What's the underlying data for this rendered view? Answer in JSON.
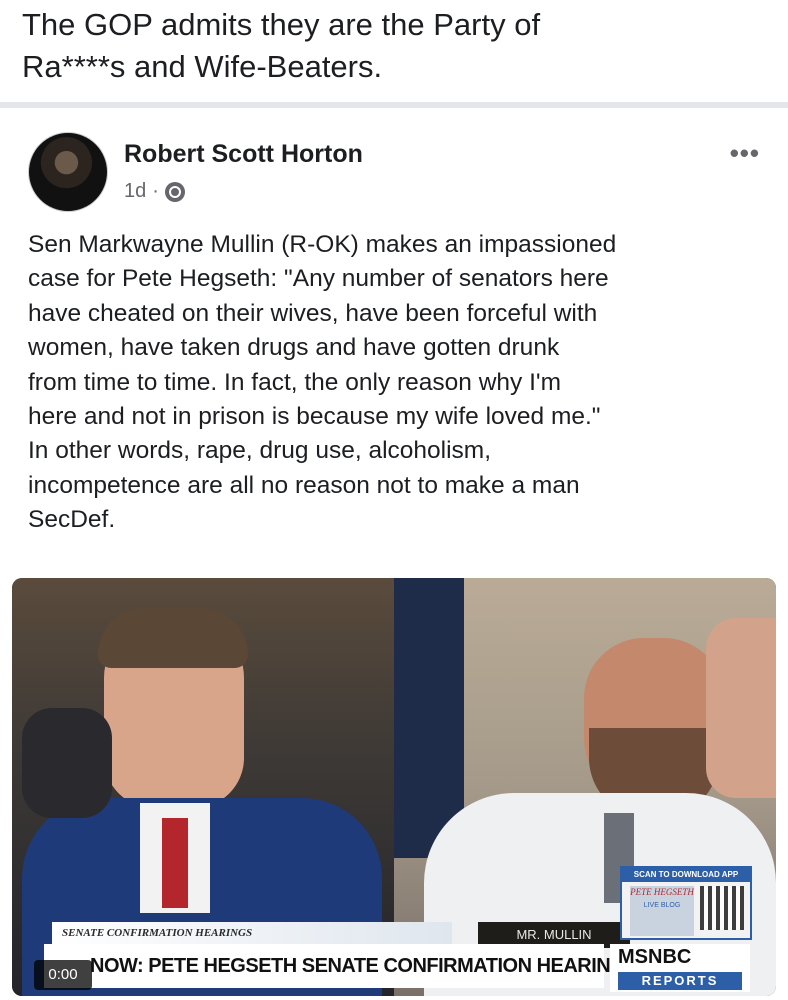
{
  "caption": {
    "line1": "The GOP admits they are the Party of",
    "line2": "Ra****s and Wife-Beaters."
  },
  "post": {
    "author": "Robert Scott Horton",
    "time": "1d",
    "separator": "·",
    "more_icon": "more-horizontal-icon",
    "privacy_icon": "globe-icon",
    "text_lines": [
      "Sen Markwayne Mullin (R-OK) makes an impassioned",
      "case for Pete Hegseth: \"Any number of senators here",
      "have cheated on their wives, have been forceful with",
      "women, have taken drugs and have gotten drunk",
      "from time to time. In fact, the only reason why I'm",
      "here and not in prison is because my wife loved me.\"",
      "In other words, rape, drug use, alcoholism,",
      "incompetence are all no reason not to make a man",
      "SecDef."
    ]
  },
  "video": {
    "time": "0:00",
    "strip": "SENATE CONFIRMATION HEARINGS",
    "name_plate": "MR. MULLIN",
    "headline": "NOW: PETE HEGSETH SENATE CONFIRMATION HEARING",
    "network": "MSNBC",
    "reports": "REPORTS",
    "scan_title": "SCAN TO DOWNLOAD APP",
    "mini_poster": "PETE HEGSETH",
    "live": "LIVE BLOG"
  }
}
